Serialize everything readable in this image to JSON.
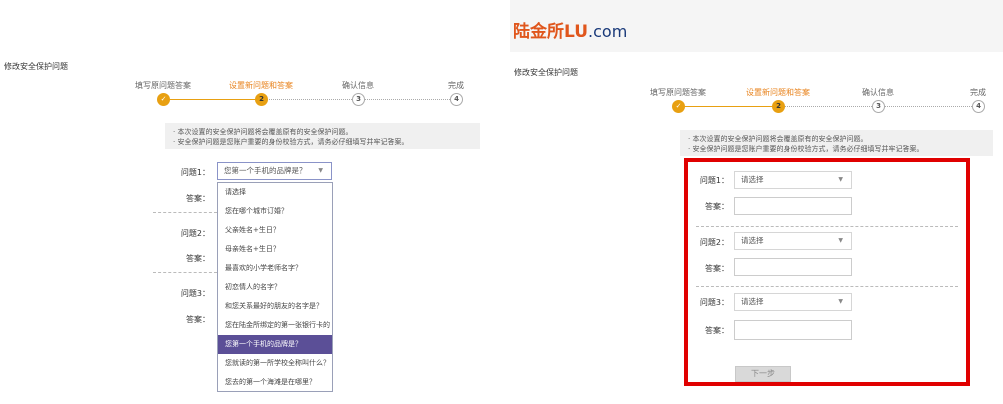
{
  "left": {
    "page_title": "修改安全保护问题",
    "steps": [
      {
        "label": "填写原问题答案",
        "num": "✓"
      },
      {
        "label": "设置新问题和答案",
        "num": "2"
      },
      {
        "label": "确认信息",
        "num": "3"
      },
      {
        "label": "完成",
        "num": "4"
      }
    ],
    "notice": [
      "本次设置的安全保护问题将会覆盖原有的安全保护问题。",
      "安全保护问题是您账户重要的身份校验方式，请务必仔细填写并牢记答案。"
    ],
    "q1_label": "问题1：",
    "q1_value": "您第一个手机的品牌是？",
    "answer_label": "答案：",
    "q2_label": "问题2：",
    "q3_label": "问题3：",
    "dropdown_options": [
      "请选择",
      "您在哪个城市订婚？",
      "父亲姓名+生日？",
      "母亲姓名+生日？",
      "最喜欢的小学老师名字？",
      "初恋情人的名字？",
      "和您关系最好的朋友的名字是？",
      "您在陆金所绑定的第一张银行卡的",
      "您第一个手机的品牌是？",
      "您就读的第一所学校全称叫什么？",
      "您去的第一个海滩是在哪里？"
    ],
    "selected_option_index": 8
  },
  "right": {
    "logo_cn": "陆金所",
    "logo_lu": "LU",
    "logo_com": ".com",
    "page_title": "修改安全保护问题",
    "steps": [
      {
        "label": "填写原问题答案",
        "num": "✓"
      },
      {
        "label": "设置新问题和答案",
        "num": "2"
      },
      {
        "label": "确认信息",
        "num": "3"
      },
      {
        "label": "完成",
        "num": "4"
      }
    ],
    "notice": [
      "本次设置的安全保护问题将会覆盖原有的安全保护问题。",
      "安全保护问题是您账户重要的身份校验方式，请务必仔细填写并牢记答案。"
    ],
    "q1_label": "问题1：",
    "q2_label": "问题2：",
    "q3_label": "问题3：",
    "select_placeholder": "请选择",
    "answer_label": "答案：",
    "next_button": "下一步"
  },
  "colors": {
    "accent_orange": "#e8a012",
    "highlight_red": "#e00000",
    "selected_purple": "#5b4f97"
  }
}
